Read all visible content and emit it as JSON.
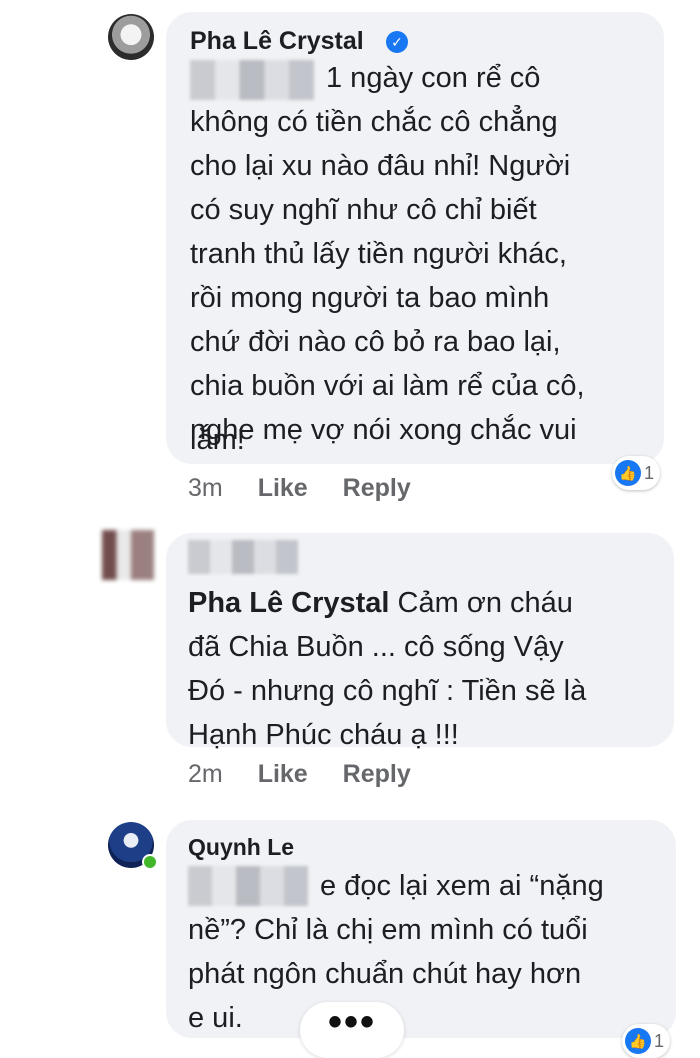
{
  "comments": [
    {
      "author": "Pha Lê Crystal",
      "verified": true,
      "lines": [
        "1 ngày con rể cô",
        "không có tiền chắc cô chẳng",
        "cho lại xu nào đâu nhỉ! Người",
        "có suy nghĩ như cô chỉ biết",
        "tranh thủ lấy tiền người khác,",
        "rồi mong người ta bao mình",
        "chứ đời nào cô bỏ ra bao lại,",
        "chia buồn với ai làm rể của cô,",
        "nghe mẹ vợ nói xong chắc vui",
        "lắm!"
      ],
      "time": "3m",
      "like_label": "Like",
      "reply_label": "Reply",
      "reaction_count": "1"
    },
    {
      "author": "",
      "reply_to": "Pha Lê Crystal",
      "lines": [
        "Cảm ơn cháu",
        "đã Chia Buồn ... cô sống Vậy",
        "Đó - nhưng cô nghĩ : Tiền sẽ là",
        "Hạnh Phúc cháu ạ !!!"
      ],
      "time": "2m",
      "like_label": "Like",
      "reply_label": "Reply"
    },
    {
      "author": "Quynh Le",
      "lines": [
        "e đọc lại xem ai “nặng",
        "nề”? Chỉ là chị em mình có tuổi",
        "phát ngôn chuẩn chút hay hơn",
        "e ui."
      ],
      "reaction_count": "1",
      "more_label": "•••"
    }
  ],
  "icons": {
    "verified": "verified-check-icon",
    "reaction": "like-thumb-icon"
  },
  "colors": {
    "bubble": "#f0f2f5",
    "action_text": "#65676b",
    "accent": "#1877f2"
  }
}
